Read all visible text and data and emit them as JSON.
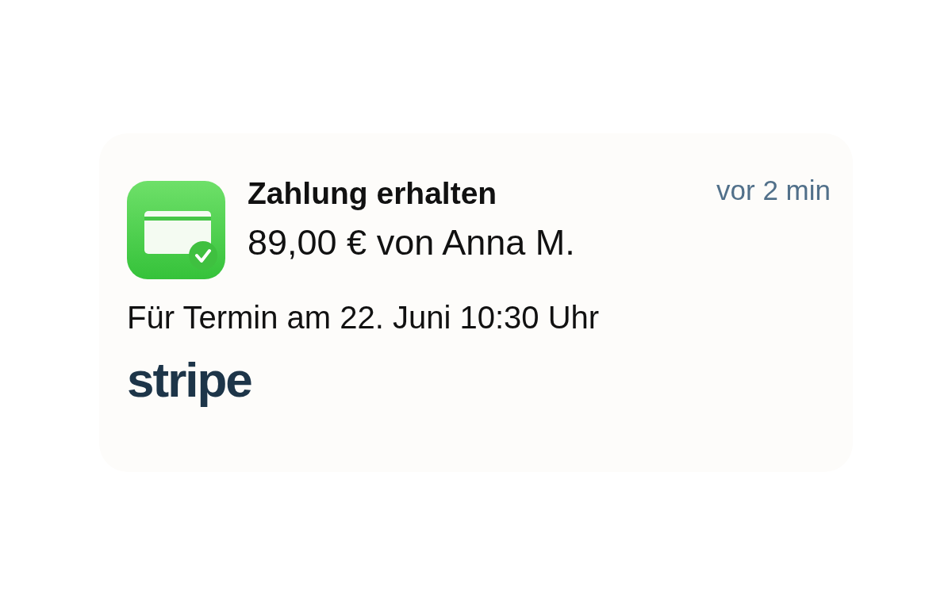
{
  "notification": {
    "title": "Zahlung erhalten",
    "amount": "89,00 € von Anna M.",
    "time": "vor 2 min",
    "detail": "Für Termin am 22. Juni 10:30 Uhr",
    "brand": "stripe"
  }
}
